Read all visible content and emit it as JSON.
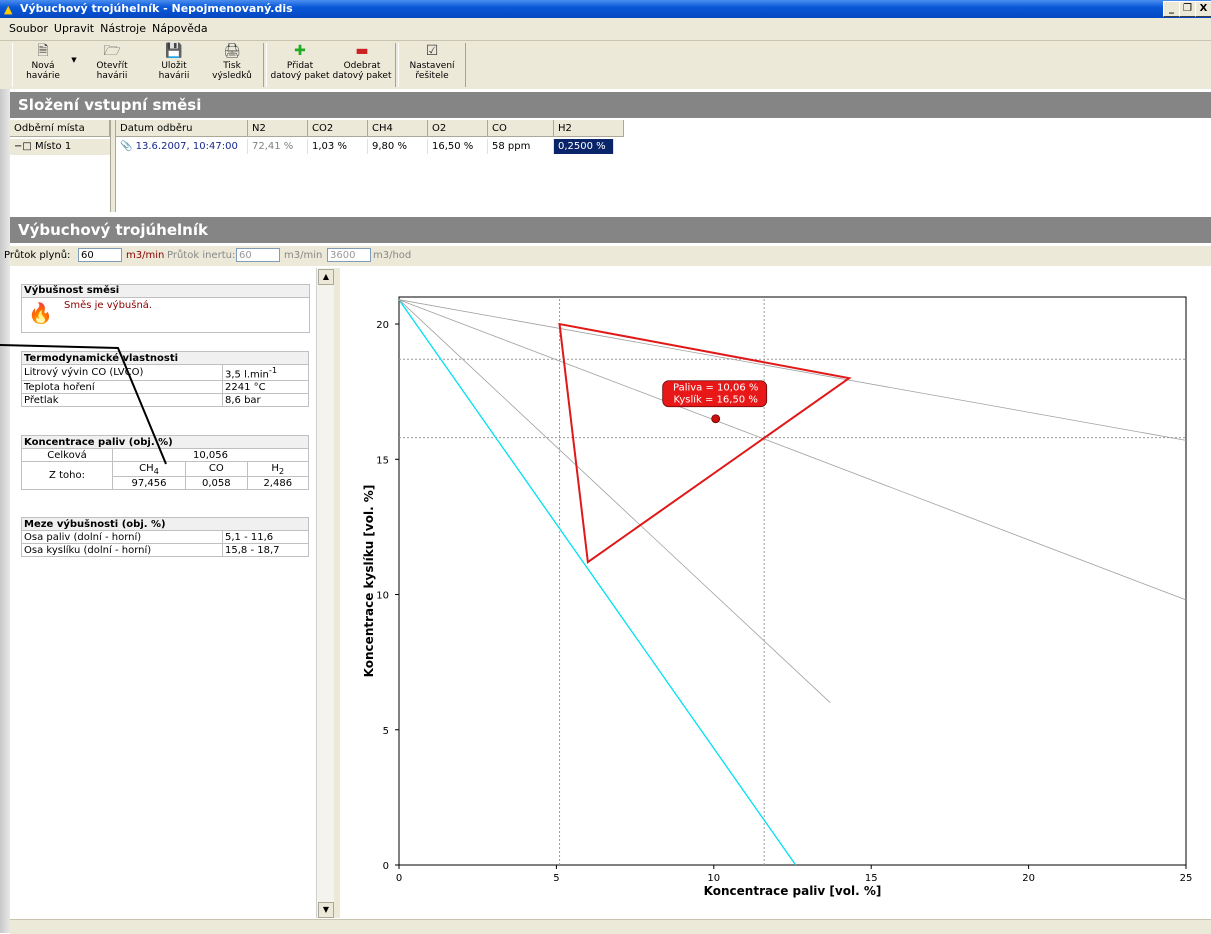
{
  "window": {
    "title": "Výbuchový trojúhelník - Nepojmenovaný.dis",
    "minimize": "_",
    "maximize": "❐",
    "close": "X"
  },
  "menu": [
    "Soubor",
    "Upravit",
    "Nástroje",
    "Nápověda"
  ],
  "toolbar": {
    "new_l1": "Nová",
    "new_l2": "havárie",
    "open_l1": "Otevřít",
    "open_l2": "havárii",
    "save_l1": "Uložit",
    "save_l2": "havárii",
    "print_l1": "Tisk",
    "print_l2": "výsledků",
    "add_l1": "Přidat",
    "add_l2": "datový paket",
    "remove_l1": "Odebrat",
    "remove_l2": "datový paket",
    "settings_l1": "Nastavení",
    "settings_l2": "řešitele"
  },
  "section1_title": "Složení vstupní směsi",
  "grid": {
    "left_header": "Odběrní místa",
    "left_item": "Místo 1",
    "headers": [
      "Datum odběru",
      "N2",
      "CO2",
      "CH4",
      "O2",
      "CO",
      "H2"
    ],
    "row": [
      "13.6.2007, 10:47:00",
      "72,41 %",
      "1,03 %",
      "9,80 %",
      "16,50 %",
      "58 ppm",
      "0,2500 %"
    ]
  },
  "section2_title": "Výbuchový trojúhelník",
  "flow": {
    "gas_label": "Průtok plynů:",
    "gas_value": "60",
    "gas_unit": "m3/min",
    "inert_label": "Průtok inertu:",
    "inert_value": "60",
    "inert_unit": "m3/min",
    "inert_value2": "3600",
    "inert_unit2": "m3/hod"
  },
  "explosivity": {
    "title": "Výbušnost směsi",
    "text": "Směs je výbušná."
  },
  "thermo": {
    "title": "Termodynamické vlastnosti",
    "rows": [
      {
        "label": "Litrový vývin CO (LVCO)",
        "value": "3,5 l.min",
        "sup": "-1"
      },
      {
        "label": "Teplota hoření",
        "value": "2241 °C"
      },
      {
        "label": "Přetlak",
        "value": "8,6 bar"
      }
    ]
  },
  "conc": {
    "title": "Koncentrace paliv (obj. %)",
    "total_label": "Celková",
    "total_value": "10,056",
    "of_label": "Z toho:",
    "species": [
      {
        "base": "CH",
        "sub": "4",
        "value": "97,456"
      },
      {
        "base": "CO",
        "sub": "",
        "value": "0,058"
      },
      {
        "base": "H",
        "sub": "2",
        "value": "2,486"
      }
    ]
  },
  "limits": {
    "title": "Meze výbušnosti (obj. %)",
    "rows": [
      {
        "label": "Osa paliv (dolní - horní)",
        "value": "5,1 - 11,6"
      },
      {
        "label": "Osa kyslíku (dolní - horní)",
        "value": "15,8 - 18,7"
      }
    ]
  },
  "chart_data": {
    "type": "scatter",
    "xlabel": "Koncentrace paliv [vol. %]",
    "ylabel": "Koncentrace kyslíku [vol. %]",
    "xlim": [
      0,
      25
    ],
    "ylim": [
      0,
      21
    ],
    "xticks": [
      0,
      5,
      10,
      15,
      20,
      25
    ],
    "yticks": [
      0,
      5,
      10,
      15,
      20
    ],
    "triangle": [
      [
        5.1,
        20.0
      ],
      [
        14.3,
        18.0
      ],
      [
        6.0,
        11.2
      ]
    ],
    "point": {
      "x": 10.06,
      "y": 16.5
    },
    "tooltip": [
      "Paliva = 10,06 %",
      "Kyslík = 16,50 %"
    ],
    "guide_lines": {
      "x": [
        5.1,
        11.6
      ],
      "y": [
        18.7,
        15.8
      ]
    },
    "lines": [
      {
        "name": "air",
        "color": "#00e0f0",
        "points": [
          [
            0,
            20.9
          ],
          [
            12.6,
            0
          ]
        ]
      },
      {
        "name": "gray1",
        "color": "#a0a0a0",
        "points": [
          [
            0,
            20.9
          ],
          [
            25,
            15.7
          ]
        ]
      },
      {
        "name": "gray2",
        "color": "#a0a0a0",
        "points": [
          [
            0,
            20.9
          ],
          [
            25,
            9.8
          ]
        ]
      },
      {
        "name": "gray3",
        "color": "#a0a0a0",
        "points": [
          [
            0,
            20.9
          ],
          [
            13.7,
            6.0
          ]
        ]
      }
    ],
    "colors": {
      "triangle": "#e01818",
      "point": "#cc1010"
    }
  }
}
